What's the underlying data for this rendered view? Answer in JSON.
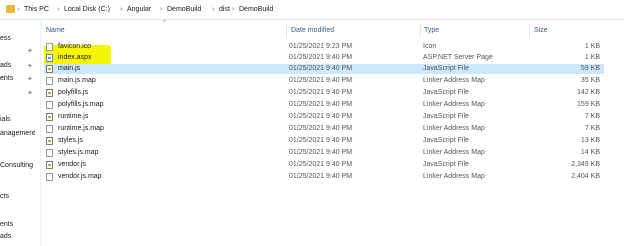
{
  "address": {
    "segments": [
      "This PC",
      "Local Disk (C:)",
      "Angular",
      "DemoBuild",
      "dist",
      "DemoBuild"
    ]
  },
  "nav": {
    "items": [
      "ess",
      "ads",
      "ents",
      "ials",
      "anagement",
      "Consulting",
      "cts",
      "ents",
      "ads"
    ]
  },
  "columns": {
    "name": "Name",
    "date": "Date modified",
    "type": "Type",
    "size": "Size"
  },
  "files": [
    {
      "name": "favicon.ico",
      "date": "01/25/2021 9:23 PM",
      "type": "Icon",
      "size": "1 KB",
      "icon": "file-icon"
    },
    {
      "name": "index.aspx",
      "date": "01/25/2021 9:40 PM",
      "type": "ASP.NET Server Page",
      "size": "1 KB",
      "icon": "aspx-file-icon"
    },
    {
      "name": "main.js",
      "date": "01/25/2021 9:40 PM",
      "type": "JavaScript File",
      "size": "59 KB",
      "icon": "js-file-icon"
    },
    {
      "name": "main.js.map",
      "date": "01/25/2021 9:40 PM",
      "type": "Linker Address Map",
      "size": "35 KB",
      "icon": "file-icon"
    },
    {
      "name": "polyfills.js",
      "date": "01/25/2021 9:40 PM",
      "type": "JavaScript File",
      "size": "142 KB",
      "icon": "js-file-icon"
    },
    {
      "name": "polyfills.js.map",
      "date": "01/25/2021 9:40 PM",
      "type": "Linker Address Map",
      "size": "159 KB",
      "icon": "file-icon"
    },
    {
      "name": "runtime.js",
      "date": "01/25/2021 9:40 PM",
      "type": "JavaScript File",
      "size": "7 KB",
      "icon": "js-file-icon"
    },
    {
      "name": "runtime.js.map",
      "date": "01/25/2021 9:40 PM",
      "type": "Linker Address Map",
      "size": "7 KB",
      "icon": "file-icon"
    },
    {
      "name": "styles.js",
      "date": "01/25/2021 9:40 PM",
      "type": "JavaScript File",
      "size": "13 KB",
      "icon": "js-file-icon"
    },
    {
      "name": "styles.js.map",
      "date": "01/25/2021 9:40 PM",
      "type": "Linker Address Map",
      "size": "14 KB",
      "icon": "file-icon"
    },
    {
      "name": "vendor.js",
      "date": "01/25/2021 9:40 PM",
      "type": "JavaScript File",
      "size": "2,349 KB",
      "icon": "js-file-icon"
    },
    {
      "name": "vendor.js.map",
      "date": "01/25/2021 9:40 PM",
      "type": "Linker Address Map",
      "size": "2,404 KB",
      "icon": "file-icon"
    }
  ],
  "colors": {
    "highlight": "#f5f50a",
    "selected_row": "#cce8ff"
  }
}
